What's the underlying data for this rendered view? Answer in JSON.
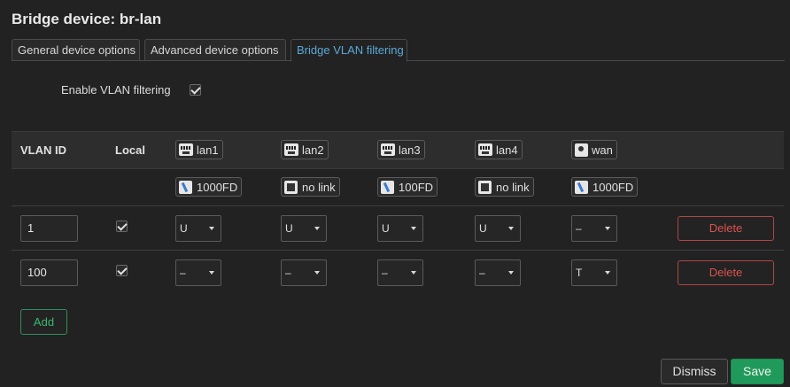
{
  "title": "Bridge device: br-lan",
  "tabs": [
    {
      "label": "General device options"
    },
    {
      "label": "Advanced device options"
    },
    {
      "label": "Bridge VLAN filtering"
    }
  ],
  "active_tab": "Bridge VLAN filtering",
  "option": {
    "label": "Enable VLAN filtering",
    "checked": true
  },
  "table": {
    "headers": {
      "vlan_id": "VLAN ID",
      "local": "Local"
    },
    "ports": [
      {
        "name": "lan1",
        "icon": "ethernet-port-icon",
        "status": "1000FD",
        "status_icon": "link-up-icon"
      },
      {
        "name": "lan2",
        "icon": "ethernet-port-icon",
        "status": "no link",
        "status_icon": "no-link-icon"
      },
      {
        "name": "lan3",
        "icon": "ethernet-port-icon",
        "status": "100FD",
        "status_icon": "link-up-icon"
      },
      {
        "name": "lan4",
        "icon": "ethernet-port-icon",
        "status": "no link",
        "status_icon": "no-link-icon"
      },
      {
        "name": "wan",
        "icon": "wan-port-icon",
        "status": "1000FD",
        "status_icon": "link-up-icon"
      }
    ],
    "rows": [
      {
        "vlan_id": "1",
        "local": true,
        "values": [
          "U",
          "U",
          "U",
          "U",
          "–"
        ],
        "delete_label": "Delete"
      },
      {
        "vlan_id": "100",
        "local": true,
        "values": [
          "–",
          "–",
          "–",
          "–",
          "T"
        ],
        "delete_label": "Delete"
      }
    ]
  },
  "buttons": {
    "add": "Add",
    "dismiss": "Dismiss",
    "save": "Save"
  },
  "colors": {
    "active_tab": "#5aa9d6",
    "add": "#3ab873",
    "delete": "#d9534f",
    "save": "#1f9a5a"
  }
}
